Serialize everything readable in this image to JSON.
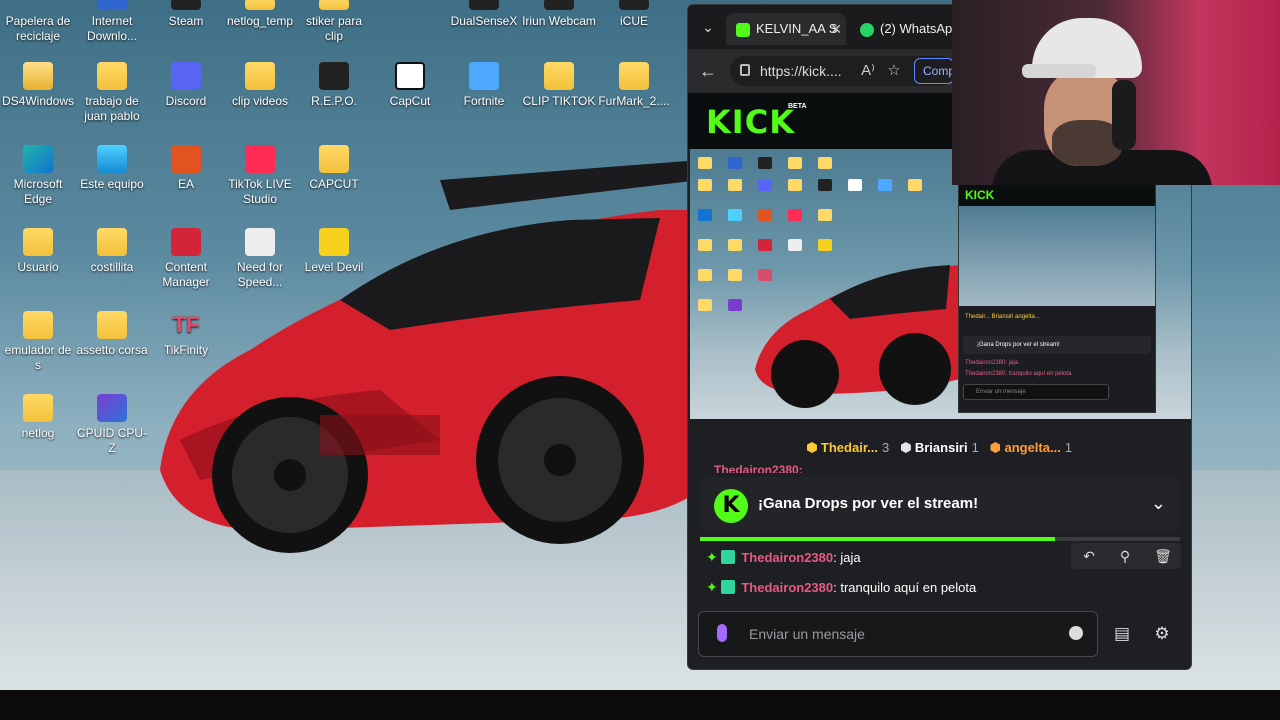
{
  "desktop": {
    "icons": [
      {
        "label": "Papelera de reciclaje"
      },
      {
        "label": "Internet Downlo..."
      },
      {
        "label": "Steam"
      },
      {
        "label": "netlog_temp"
      },
      {
        "label": "stiker para clip"
      },
      {
        "label": "DualSenseX"
      },
      {
        "label": "Iriun Webcam"
      },
      {
        "label": "iCUE"
      },
      {
        "label": "DS4Windows"
      },
      {
        "label": "trabajo de juan pablo"
      },
      {
        "label": "Discord"
      },
      {
        "label": "clip videos"
      },
      {
        "label": "R.E.P.O."
      },
      {
        "label": "CapCut"
      },
      {
        "label": "Fortnite"
      },
      {
        "label": "CLIP TIKTOK"
      },
      {
        "label": "FurMark_2...."
      },
      {
        "label": "Microsoft Edge"
      },
      {
        "label": "Este equipo"
      },
      {
        "label": "EA"
      },
      {
        "label": "TikTok LIVE Studio"
      },
      {
        "label": "CAPCUT"
      },
      {
        "label": "Usuario"
      },
      {
        "label": "costillita"
      },
      {
        "label": "Content Manager"
      },
      {
        "label": "Need for Speed..."
      },
      {
        "label": "Level Devil"
      },
      {
        "label": "emulador de s"
      },
      {
        "label": "assetto corsa"
      },
      {
        "label": "TikFinity"
      },
      {
        "label": "netlog"
      },
      {
        "label": "CPUID CPU-Z"
      }
    ],
    "tikfinity_glyph": "TF"
  },
  "browser": {
    "tabs": {
      "active_label": "KELVIN_AA S",
      "inactive_label": "(2) WhatsAp"
    },
    "url": "https://kick....",
    "share_label": "Comp",
    "read_aloud_icon": "A⁾",
    "kick_logo": "KICK",
    "kick_beta": "BETA"
  },
  "stream_preview": {
    "nested_logo": "KICK",
    "nested_leaderboard": "Thedair...   Briansiri   angelta...",
    "nested_drops": "¡Gana Drops por ver el stream!",
    "nested_msg1": "Thedairon2380: jaja",
    "nested_msg2": "Thedairon2380: tranquilo aquí en pelota",
    "nested_input": "Enviar un mensaje"
  },
  "leaderboard": [
    {
      "name": "Thedair...",
      "count": "3",
      "color": "#ffca3a"
    },
    {
      "name": "Briansiri",
      "count": "1",
      "color": "#ffffff"
    },
    {
      "name": "angelta...",
      "count": "1",
      "color": "#ff9e3d"
    }
  ],
  "chat": {
    "peek_text": "Thedairon2380:",
    "drops_logo": "K",
    "drops_title": "¡Gana Drops por ver el stream!",
    "drops_progress": 0.74,
    "messages": [
      {
        "user": "Thedairon2380",
        "text": ": jaja"
      },
      {
        "user": "Thedairon2380",
        "text": ": tranquilo aquí en pelota"
      }
    ],
    "input_placeholder": "Enviar un mensaje"
  },
  "colors": {
    "kick_green": "#53fc18",
    "username_pink": "#e85a85"
  }
}
